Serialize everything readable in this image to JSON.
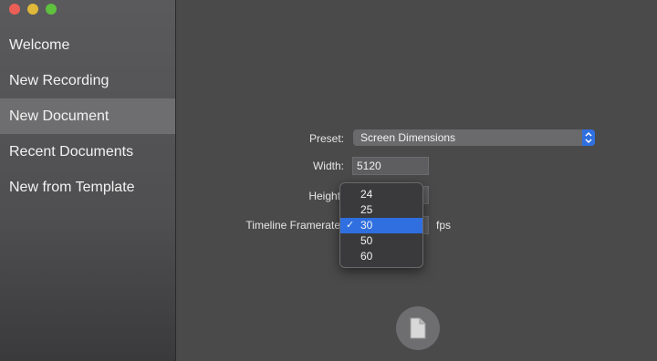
{
  "sidebar": {
    "items": [
      {
        "label": "Welcome"
      },
      {
        "label": "New Recording"
      },
      {
        "label": "New Document"
      },
      {
        "label": "Recent Documents"
      },
      {
        "label": "New from Template"
      }
    ],
    "active_index": 2
  },
  "form": {
    "preset": {
      "label": "Preset:",
      "value": "Screen Dimensions"
    },
    "width": {
      "label": "Width:",
      "value": "5120"
    },
    "height": {
      "label": "Height"
    },
    "framerate": {
      "label": "Timeline Framerate",
      "unit": "fps"
    }
  },
  "framerate_menu": {
    "options": [
      "24",
      "25",
      "30",
      "50",
      "60"
    ],
    "selected": "30"
  },
  "icons": {
    "create": "document-icon"
  },
  "colors": {
    "accent": "#2f6fe0"
  }
}
